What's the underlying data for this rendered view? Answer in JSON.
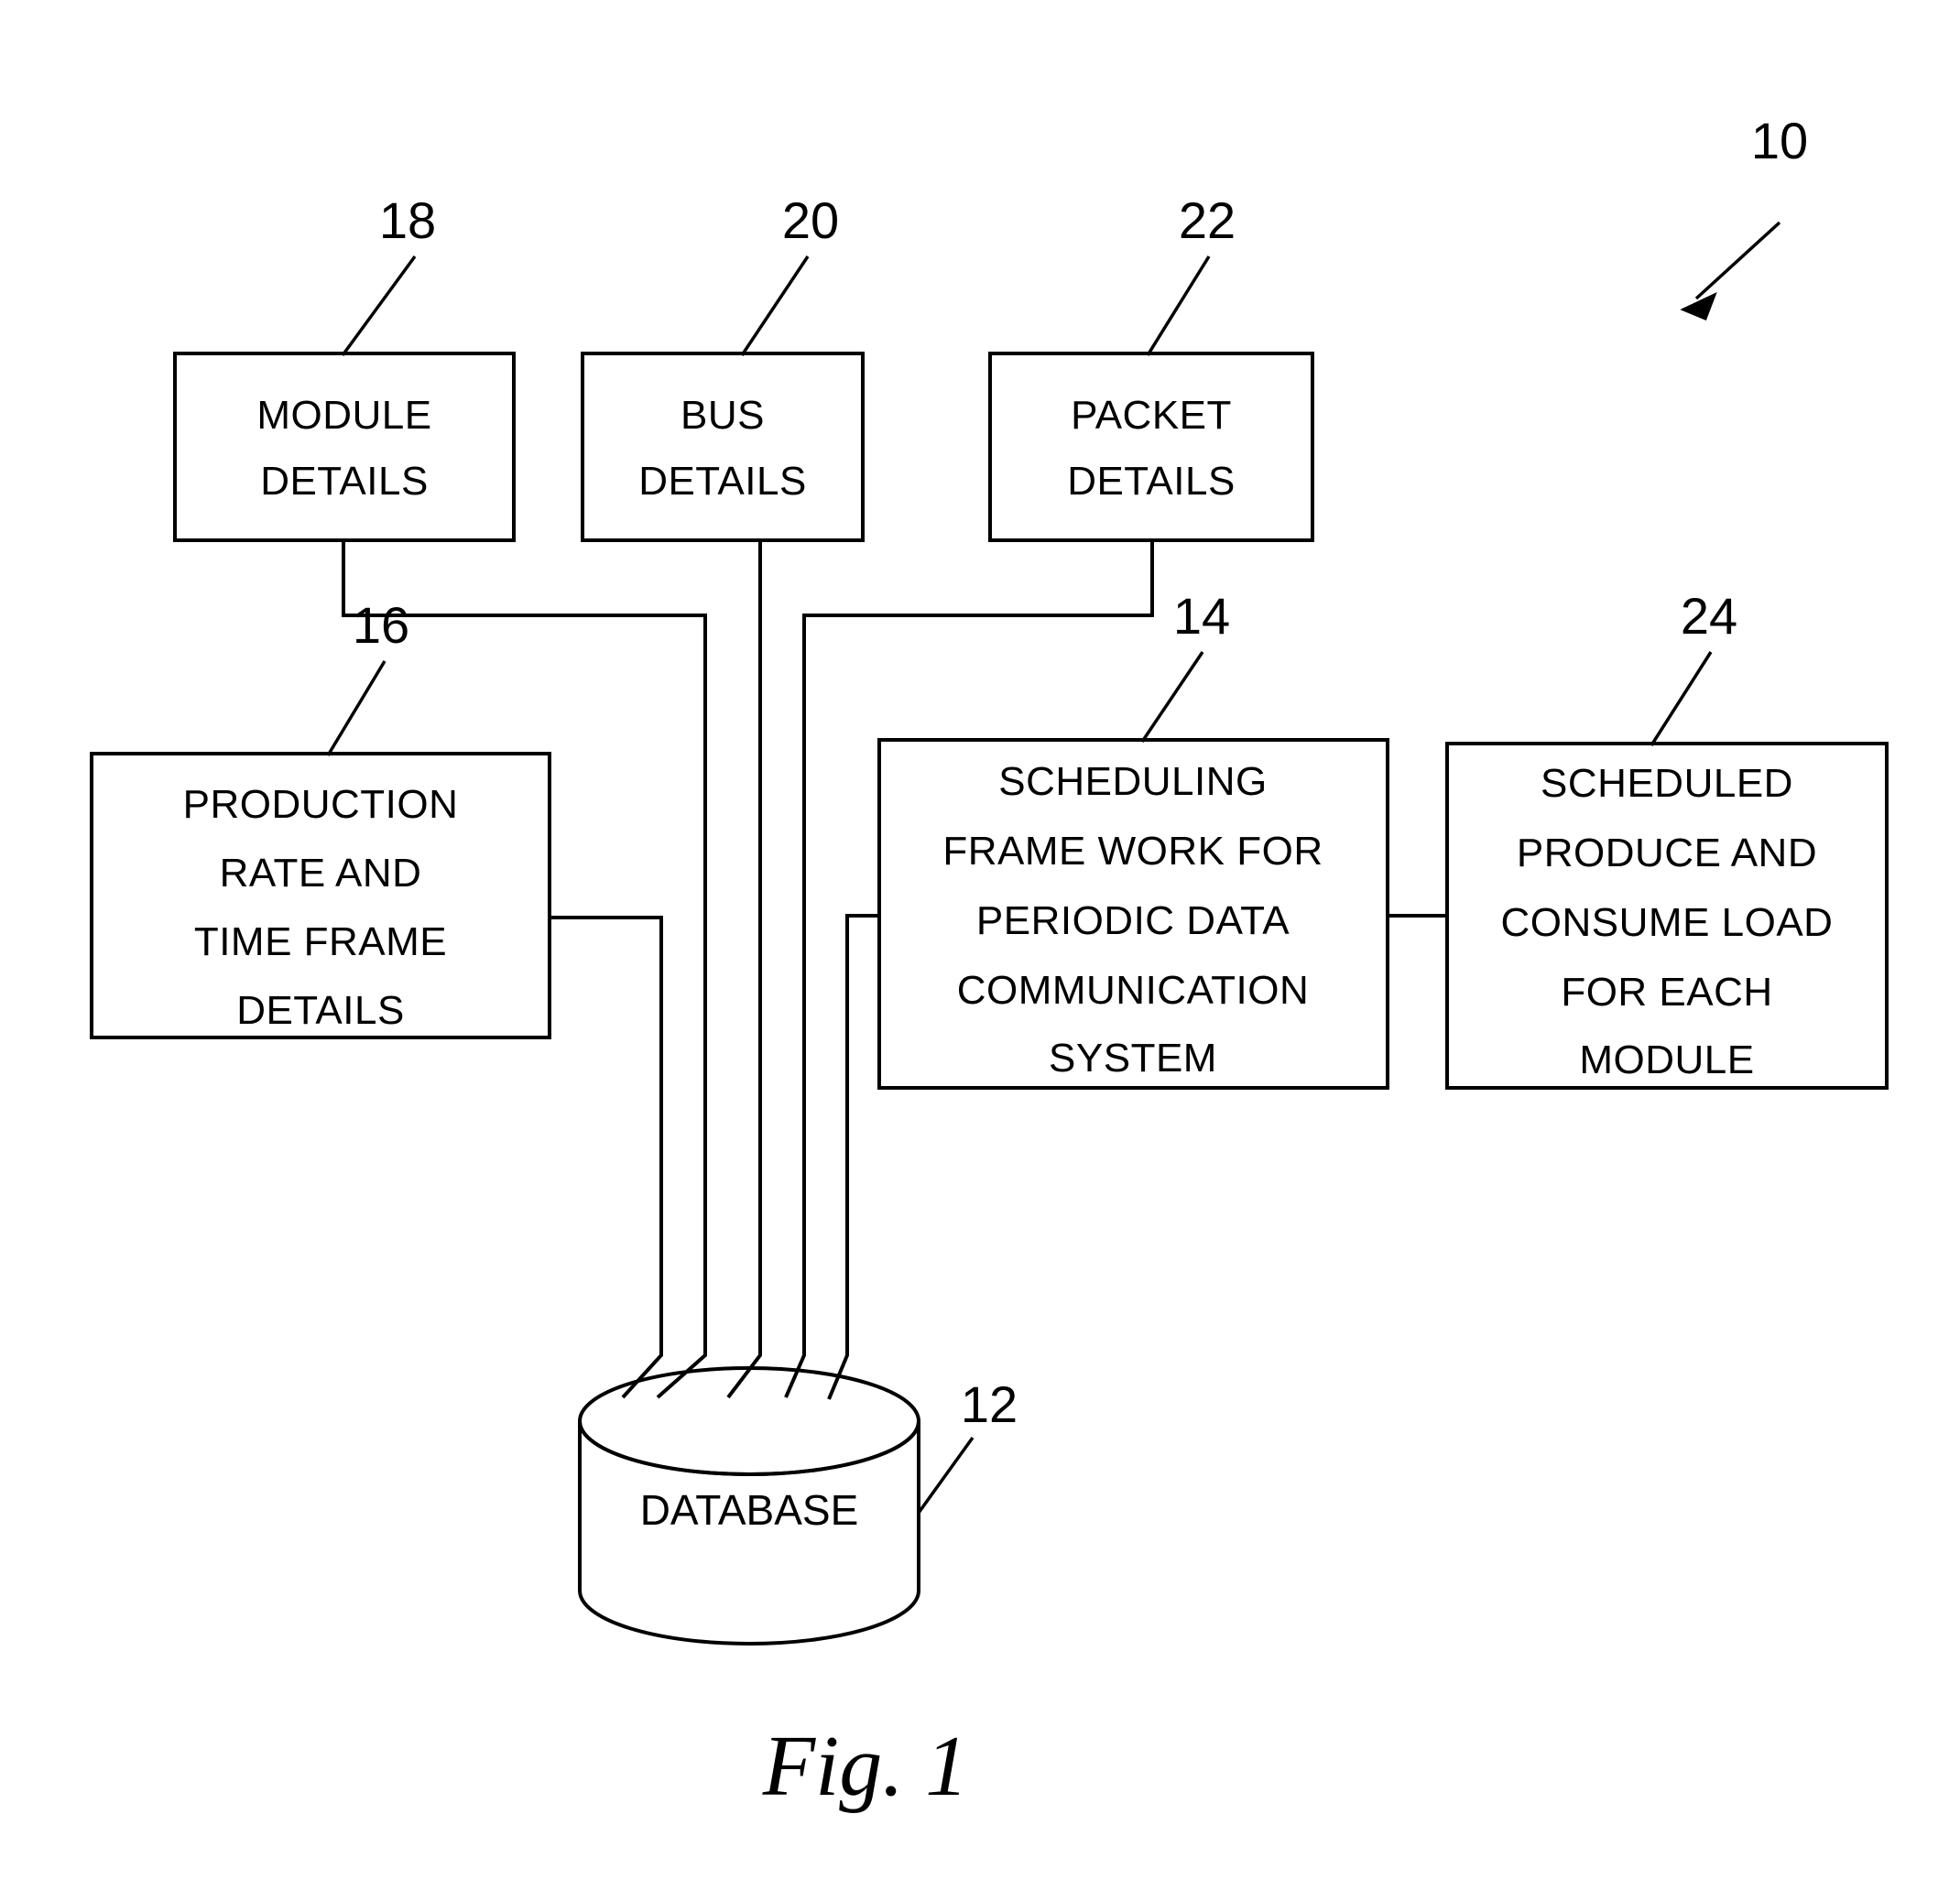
{
  "figure": {
    "caption": "Fig. 1",
    "system_ref": "10"
  },
  "nodes": [
    {
      "id": "module-details",
      "ref": "18",
      "lines": [
        "MODULE",
        "DETAILS"
      ],
      "line1": "MODULE",
      "line2": "DETAILS",
      "line3": "",
      "line4": "",
      "line5": ""
    },
    {
      "id": "bus-details",
      "ref": "20",
      "lines": [
        "BUS",
        "DETAILS"
      ],
      "line1": "BUS",
      "line2": "DETAILS",
      "line3": "",
      "line4": "",
      "line5": ""
    },
    {
      "id": "packet-details",
      "ref": "22",
      "lines": [
        "PACKET",
        "DETAILS"
      ],
      "line1": "PACKET",
      "line2": "DETAILS",
      "line3": "",
      "line4": "",
      "line5": ""
    },
    {
      "id": "production-rate",
      "ref": "16",
      "lines": [
        "PRODUCTION",
        "RATE AND",
        "TIME FRAME",
        "DETAILS"
      ],
      "line1": "PRODUCTION",
      "line2": "RATE AND",
      "line3": "TIME FRAME",
      "line4": "DETAILS",
      "line5": ""
    },
    {
      "id": "scheduling-framework",
      "ref": "14",
      "lines": [
        "SCHEDULING",
        "FRAME WORK FOR",
        "PERIODIC DATA",
        "COMMUNICATION",
        "SYSTEM"
      ],
      "line1": "SCHEDULING",
      "line2": "FRAME WORK FOR",
      "line3": "PERIODIC DATA",
      "line4": "COMMUNICATION",
      "line5": "SYSTEM"
    },
    {
      "id": "scheduled-load",
      "ref": "24",
      "lines": [
        "SCHEDULED",
        "PRODUCE AND",
        "CONSUME LOAD",
        "FOR EACH",
        "MODULE"
      ],
      "line1": "SCHEDULED",
      "line2": "PRODUCE AND",
      "line3": "CONSUME LOAD",
      "line4": "FOR EACH",
      "line5": "MODULE"
    },
    {
      "id": "database",
      "ref": "12",
      "lines": [
        "DATABASE"
      ],
      "line1": "DATABASE",
      "line2": "",
      "line3": "",
      "line4": "",
      "line5": ""
    }
  ],
  "colors": {
    "stroke": "#000000",
    "fill": "#ffffff",
    "background": "#ffffff"
  }
}
